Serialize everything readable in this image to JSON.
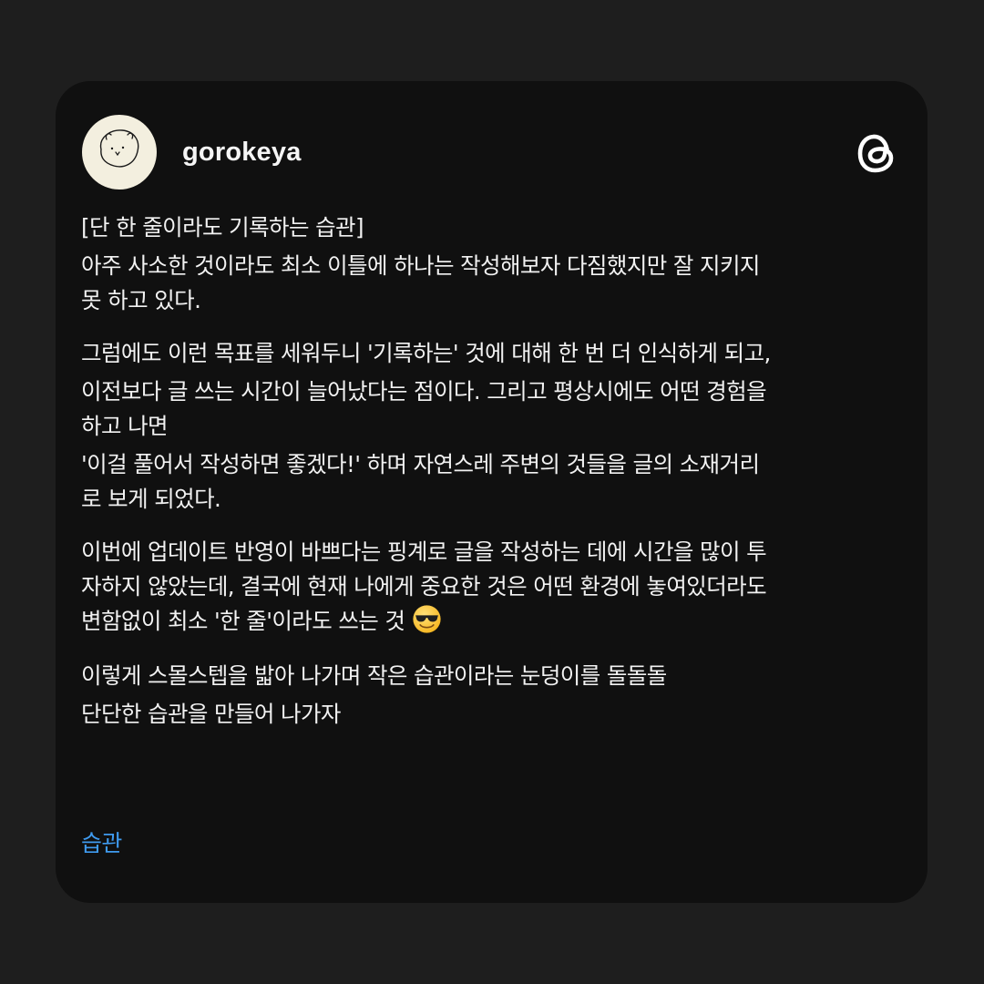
{
  "post": {
    "username": "gorokeya",
    "paragraphs": [
      {
        "lines": [
          "[단 한 줄이라도 기록하는 습관]",
          "아주 사소한 것이라도 최소 이틀에 하나는 작성해보자 다짐했지만 잘 지키지",
          "못 하고 있다."
        ]
      },
      {
        "lines": [
          "그럼에도 이런 목표를 세워두니 '기록하는' 것에 대해 한 번 더 인식하게 되고,",
          "이전보다 글 쓰는 시간이 늘어났다는 점이다. 그리고 평상시에도 어떤 경험을",
          "하고 나면",
          "'이걸 풀어서 작성하면 좋겠다!' 하며 자연스레 주변의 것들을 글의 소재거리",
          "로 보게 되었다."
        ]
      },
      {
        "lines": [
          "이번에 업데이트 반영이 바쁘다는 핑계로 글을 작성하는 데에 시간을 많이 투",
          "자하지 않았는데, 결국에 현재 나에게 중요한 것은 어떤 환경에 놓여있더라도",
          "변함없이 최소 '한 줄'이라도 쓰는 것"
        ],
        "trailing_emoji": "smiling-face-with-sunglasses"
      },
      {
        "lines": [
          "이렇게 스몰스텝을 밟아 나가며 작은 습관이라는 눈덩이를 돌돌돌",
          "단단한 습관을 만들어 나가자"
        ]
      }
    ],
    "hashtag": "습관"
  },
  "icons": {
    "app_logo": "threads-logo-icon",
    "avatar": "doodle-avatar"
  },
  "colors": {
    "page_background": "#1e1e1e",
    "card_background": "#101010",
    "text": "#f2f2f2",
    "hashtag": "#3f9bf0",
    "avatar_background": "#f3efdf"
  }
}
